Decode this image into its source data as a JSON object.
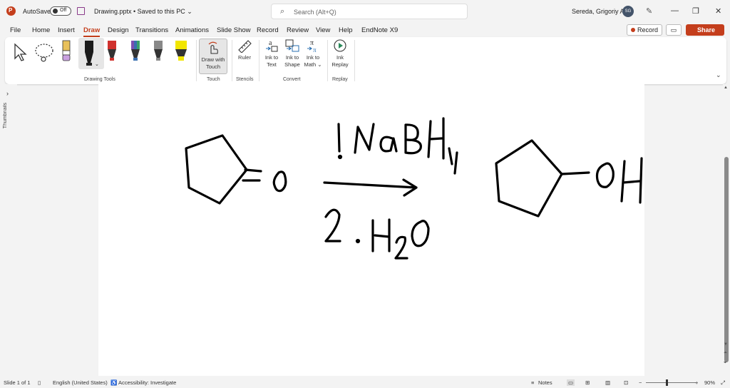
{
  "titlebar": {
    "autosave_label": "AutoSave",
    "autosave_state": "Off",
    "document": "Drawing.pptx • Saved to this PC ⌄",
    "search_placeholder": "Search (Alt+Q)",
    "user_name": "Sereda, Grigoriy A",
    "user_initials": "SG"
  },
  "menu": {
    "tabs": [
      "File",
      "Home",
      "Insert",
      "Draw",
      "Design",
      "Transitions",
      "Animations",
      "Slide Show",
      "Record",
      "Review",
      "View",
      "Help",
      "EndNote X9"
    ],
    "active_tab": "Draw",
    "record_label": "Record",
    "share_label": "Share"
  },
  "ribbon": {
    "groups": {
      "drawing_tools": "Drawing Tools",
      "touch": "Touch",
      "stencils": "Stencils",
      "convert": "Convert",
      "replay": "Replay"
    },
    "draw_with_touch": [
      "Draw with",
      "Touch"
    ],
    "ruler": "Ruler",
    "ink_to_text": [
      "Ink to",
      "Text"
    ],
    "ink_to_shape": [
      "Ink to",
      "Shape"
    ],
    "ink_to_math": [
      "Ink to",
      "Math ⌄"
    ],
    "ink_replay": [
      "Ink",
      "Replay"
    ],
    "pen_colors": [
      "#1a1a1a",
      "#d0312d",
      "#3a6fb0",
      "#888888",
      "#f2e600"
    ]
  },
  "left_rail": {
    "label": "Thumbnails"
  },
  "slide_ink": {
    "reactant_o": "O",
    "step1": "1. NaBH4",
    "step2": "2. H2O",
    "product_oh": "OH"
  },
  "status": {
    "slide": "Slide 1 of 1",
    "language": "English (United States)",
    "accessibility": "Accessibility: Investigate",
    "notes": "Notes",
    "zoom": "90%"
  },
  "colors": {
    "accent": "#c43e1c"
  }
}
